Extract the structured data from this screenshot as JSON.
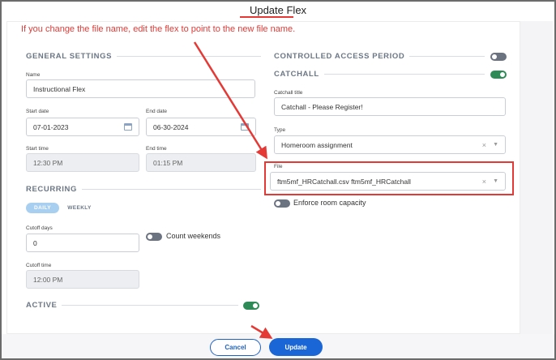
{
  "dialog": {
    "title": "Update Flex",
    "annotation": "If you change the file name, edit the flex to point to the new file name."
  },
  "general_settings": {
    "heading": "GENERAL SETTINGS",
    "name_label": "Name",
    "name_value": "Instructional Flex",
    "start_date_label": "Start date",
    "start_date_value": "07-01-2023",
    "end_date_label": "End date",
    "end_date_value": "06-30-2024",
    "start_time_label": "Start time",
    "start_time_value": "12:30 PM",
    "end_time_label": "End time",
    "end_time_value": "01:15 PM"
  },
  "recurring": {
    "heading": "RECURRING",
    "tabs": [
      {
        "label": "DAILY",
        "selected": true
      },
      {
        "label": "WEEKLY",
        "selected": false
      }
    ],
    "cutoff_days_label": "Cutoff days",
    "cutoff_days_value": "0",
    "count_weekends_label": "Count weekends",
    "count_weekends_on": false,
    "cutoff_time_label": "Cutoff time",
    "cutoff_time_value": "12:00 PM"
  },
  "active": {
    "heading": "ACTIVE",
    "on": true
  },
  "controlled_access": {
    "heading": "CONTROLLED ACCESS PERIOD",
    "on": false
  },
  "catchall": {
    "heading": "CATCHALL",
    "on": true,
    "title_label": "Catchall title",
    "title_value": "Catchall - Please Register!",
    "type_label": "Type",
    "type_value": "Homeroom assignment",
    "file_label": "File",
    "file_value": "ftm5mf_HRCatchall.csv ftm5mf_HRCatchall",
    "enforce_label": "Enforce room capacity",
    "enforce_on": false
  },
  "footer": {
    "cancel_label": "Cancel",
    "update_label": "Update"
  },
  "colors": {
    "annotation_red": "#e53935",
    "primary_blue": "#1a66d6",
    "toggle_on": "#2e8b57",
    "toggle_off": "#6b7280"
  },
  "icons": [
    "calendar-icon",
    "clear-icon",
    "chevron-down-icon"
  ]
}
